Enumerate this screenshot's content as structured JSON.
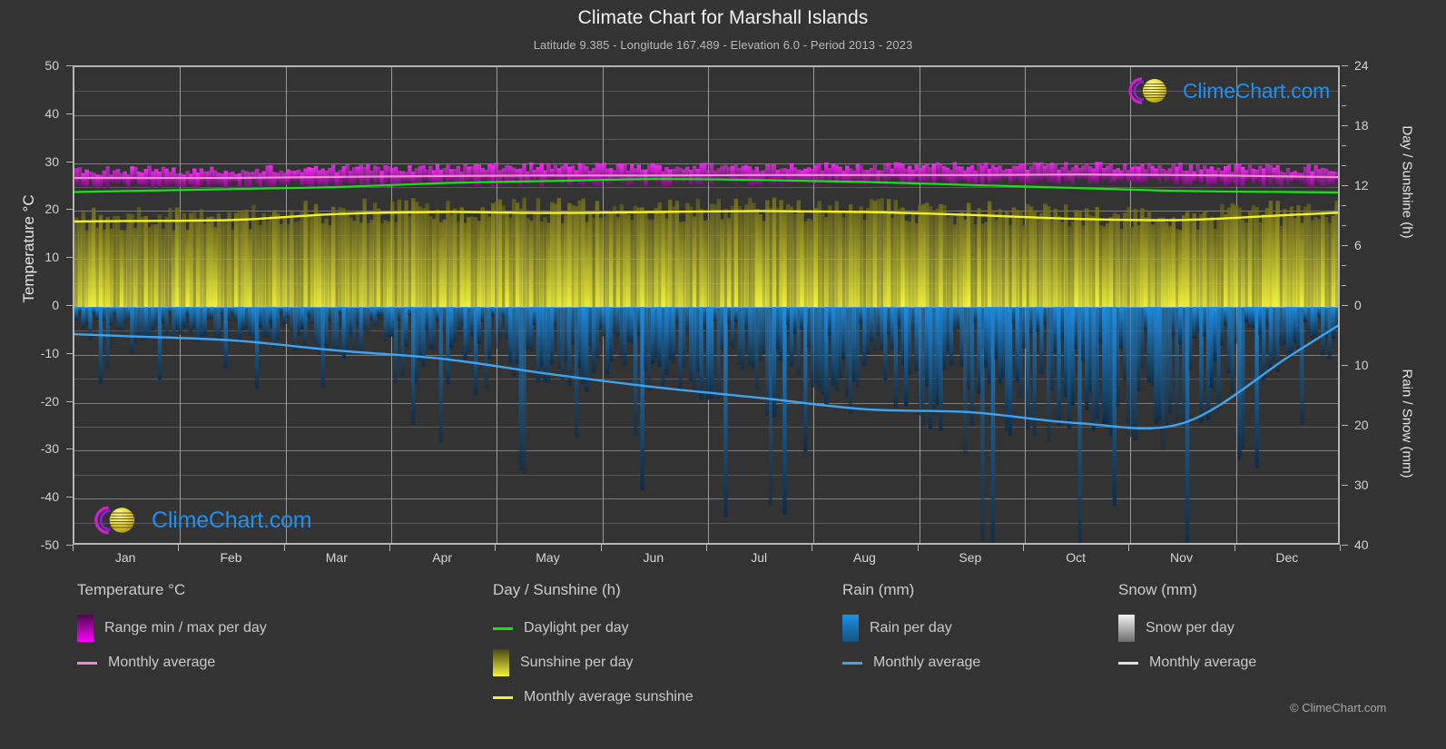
{
  "header": {
    "title": "Climate Chart for Marshall Islands",
    "subtitle": "Latitude 9.385 - Longitude 167.489 - Elevation 6.0 - Period 2013 - 2023"
  },
  "axes": {
    "left_title": "Temperature °C",
    "right_title_top": "Day / Sunshine (h)",
    "right_title_bottom": "Rain / Snow (mm)",
    "left_ticks": [
      "50",
      "40",
      "30",
      "20",
      "10",
      "0",
      "-10",
      "-20",
      "-30",
      "-40",
      "-50"
    ],
    "right_ticks_top": [
      "24",
      "18",
      "12",
      "6",
      "0"
    ],
    "right_ticks_bottom": [
      "10",
      "20",
      "30",
      "40"
    ],
    "x_ticks": [
      "Jan",
      "Feb",
      "Mar",
      "Apr",
      "May",
      "Jun",
      "Jul",
      "Aug",
      "Sep",
      "Oct",
      "Nov",
      "Dec"
    ]
  },
  "watermark": {
    "text": "ClimeChart.com"
  },
  "copyright": "© ClimeChart.com",
  "legend": {
    "temperature": {
      "heading": "Temperature °C",
      "items": [
        {
          "label": "Range min / max per day",
          "marker": "box",
          "color": "#ff00ff"
        },
        {
          "label": "Monthly average",
          "marker": "line",
          "color": "#ef8ad6"
        }
      ]
    },
    "daysun": {
      "heading": "Day / Sunshine (h)",
      "items": [
        {
          "label": "Daylight per day",
          "marker": "line",
          "color": "#14e414"
        },
        {
          "label": "Sunshine per day",
          "marker": "box",
          "color": "#eeee33"
        },
        {
          "label": "Monthly average sunshine",
          "marker": "line",
          "color": "#f2f21e"
        }
      ]
    },
    "rain": {
      "heading": "Rain (mm)",
      "items": [
        {
          "label": "Rain per day",
          "marker": "box",
          "color": "#1683e0"
        },
        {
          "label": "Monthly average",
          "marker": "line",
          "color": "#3fa3ef"
        }
      ]
    },
    "snow": {
      "heading": "Snow (mm)",
      "items": [
        {
          "label": "Snow per day",
          "marker": "box",
          "color": "#e8e8e8"
        },
        {
          "label": "Monthly average",
          "marker": "line",
          "color": "#e0e0e0"
        }
      ]
    }
  },
  "chart_data": {
    "type": "line",
    "title": "Climate Chart for Marshall Islands",
    "subtitle": "Latitude 9.385 - Longitude 167.489 - Elevation 6.0 - Period 2013 - 2023",
    "location": "Marshall Islands",
    "latitude": 9.385,
    "longitude": 167.489,
    "elevation": 6.0,
    "period": "2013 - 2023",
    "xlabel": "",
    "x": [
      "Jan",
      "Feb",
      "Mar",
      "Apr",
      "May",
      "Jun",
      "Jul",
      "Aug",
      "Sep",
      "Oct",
      "Nov",
      "Dec"
    ],
    "ylabel_left": "Temperature °C",
    "ylim_left": [
      -50,
      50
    ],
    "ylabel_right_top": "Day / Sunshine (h)",
    "ylim_right_top": [
      0,
      24
    ],
    "ylabel_right_bottom": "Rain / Snow (mm)",
    "ylim_right_bottom": [
      0,
      40
    ],
    "grid": true,
    "legend_position": "below",
    "series": [
      {
        "name": "Monthly average temperature",
        "unit": "°C",
        "axis": "left",
        "color": "#ef8ad6",
        "values": [
          26.9,
          26.9,
          27.1,
          27.3,
          27.4,
          27.4,
          27.5,
          27.5,
          27.5,
          27.6,
          27.5,
          27.2
        ]
      },
      {
        "name": "Temperature range max per day",
        "unit": "°C",
        "axis": "left",
        "color": "#ff00ff",
        "values": [
          28.4,
          28.5,
          28.7,
          29.0,
          29.1,
          29.1,
          29.2,
          29.2,
          29.2,
          29.3,
          29.1,
          28.8
        ]
      },
      {
        "name": "Temperature range min per day",
        "unit": "°C",
        "axis": "left",
        "color": "#a000a0",
        "values": [
          25.5,
          25.5,
          25.7,
          25.9,
          26.0,
          26.0,
          26.1,
          26.1,
          26.1,
          26.2,
          26.1,
          25.8
        ]
      },
      {
        "name": "Daylight per day",
        "unit": "h",
        "axis": "right_top",
        "color": "#14e414",
        "values": [
          11.6,
          11.8,
          12.0,
          12.4,
          12.6,
          12.8,
          12.7,
          12.5,
          12.2,
          11.9,
          11.6,
          11.5
        ]
      },
      {
        "name": "Monthly average sunshine",
        "unit": "h",
        "axis": "right_top",
        "color": "#f2f21e",
        "values": [
          8.6,
          8.7,
          9.3,
          9.5,
          9.4,
          9.5,
          9.6,
          9.5,
          9.2,
          8.8,
          8.7,
          9.2
        ]
      },
      {
        "name": "Monthly average rain",
        "unit": "mm",
        "axis": "right_bottom",
        "color": "#3fa3ef",
        "values": [
          4.9,
          5.6,
          7.3,
          8.7,
          11.2,
          13.4,
          15.2,
          17.1,
          17.6,
          19.4,
          19.4,
          8.3
        ]
      }
    ]
  }
}
